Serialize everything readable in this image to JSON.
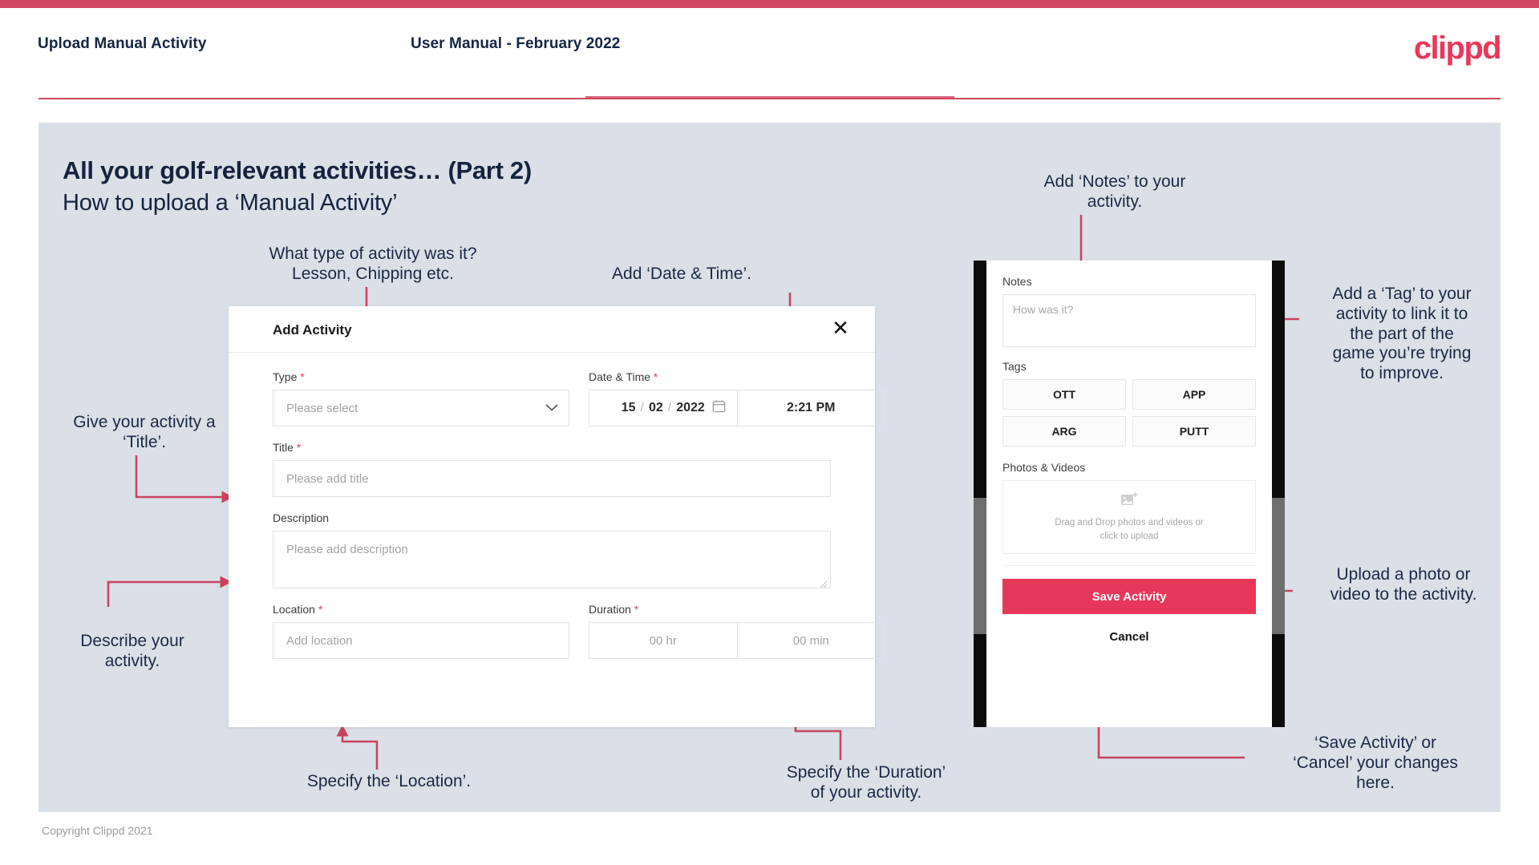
{
  "header": {
    "title": "Upload Manual Activity",
    "subtitle": "User Manual - February 2022",
    "logo": "clippd"
  },
  "slide": {
    "title": "All your golf-relevant activities… (Part 2)",
    "subtitle": "How to upload a ‘Manual Activity’"
  },
  "callouts": {
    "type": "What type of activity was it?\nLesson, Chipping etc.",
    "datetime": "Add ‘Date & Time’.",
    "title": "Give your activity a\n‘Title’.",
    "description": "Describe your\nactivity.",
    "location": "Specify the ‘Location’.",
    "duration": "Specify the ‘Duration’\nof your activity.",
    "notes": "Add ‘Notes’ to your\nactivity.",
    "tags": "Add a ‘Tag’ to your\nactivity to link it to\nthe part of the\ngame you’re trying\nto improve.",
    "upload": "Upload a photo or\nvideo to the activity.",
    "save": "‘Save Activity’ or\n‘Cancel’ your changes\nhere."
  },
  "dialog": {
    "title": "Add Activity",
    "close_icon": "close-icon",
    "fields": {
      "type": {
        "label": "Type",
        "required": "*",
        "placeholder": "Please select",
        "value": ""
      },
      "datetime": {
        "label": "Date & Time",
        "required": "*",
        "day": "15",
        "month": "02",
        "year": "2022",
        "separator": "/",
        "time": "2:21 PM"
      },
      "title": {
        "label": "Title",
        "required": "*",
        "placeholder": "Please add title",
        "value": ""
      },
      "description": {
        "label": "Description",
        "required": "",
        "placeholder": "Please add description",
        "value": ""
      },
      "location": {
        "label": "Location",
        "required": "*",
        "placeholder": "Add location",
        "value": ""
      },
      "duration": {
        "label": "Duration",
        "required": "*",
        "hours_placeholder": "00 hr",
        "minutes_placeholder": "00 min"
      }
    }
  },
  "phone": {
    "notes": {
      "label": "Notes",
      "placeholder": "How was it?",
      "value": ""
    },
    "tags": {
      "label": "Tags",
      "items": [
        "OTT",
        "APP",
        "ARG",
        "PUTT"
      ]
    },
    "photos": {
      "label": "Photos & Videos",
      "dropzone_line1": "Drag and Drop photos and videos or",
      "dropzone_line2": "click to upload",
      "icon": "add-image-icon"
    },
    "save_label": "Save Activity",
    "cancel_label": "Cancel"
  },
  "footer": {
    "copyright": "Copyright Clippd 2021"
  },
  "colors": {
    "brand": "#e8385a",
    "bar": "#cf4760",
    "slide_bg": "#dbe0e8",
    "text_dark": "#16233f",
    "arrow": "#c94361"
  }
}
